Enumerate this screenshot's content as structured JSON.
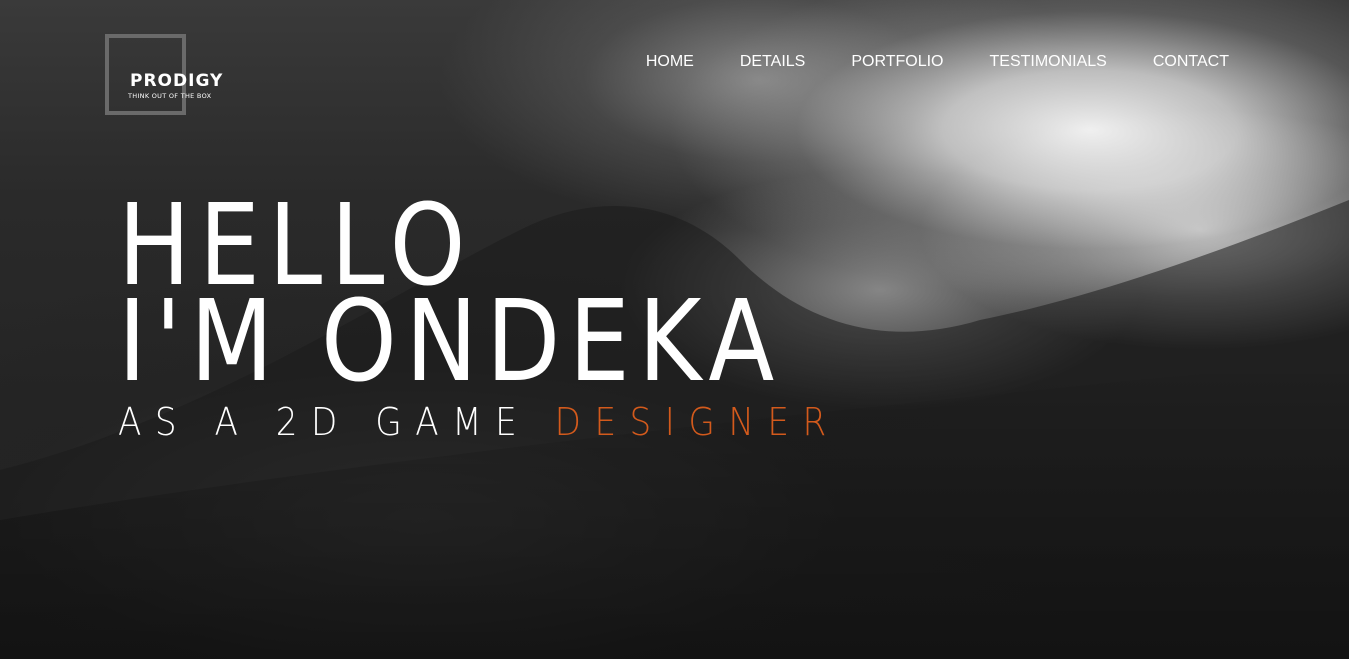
{
  "logo": {
    "name": "PRODIGY",
    "tagline": "THINK OUT OF THE BOX"
  },
  "nav": {
    "items": [
      {
        "label": "HOME"
      },
      {
        "label": "DETAILS"
      },
      {
        "label": "PORTFOLIO"
      },
      {
        "label": "TESTIMONIALS"
      },
      {
        "label": "CONTACT"
      }
    ]
  },
  "hero": {
    "line1": "HELLO",
    "line2": "I'M ONDEKA",
    "subtitle_prefix": "AS A 2D GAME",
    "subtitle_accent": "DESIGNER"
  },
  "colors": {
    "accent": "#d35a1c",
    "text": "#ffffff",
    "logo_box": "#6a6a6a"
  }
}
